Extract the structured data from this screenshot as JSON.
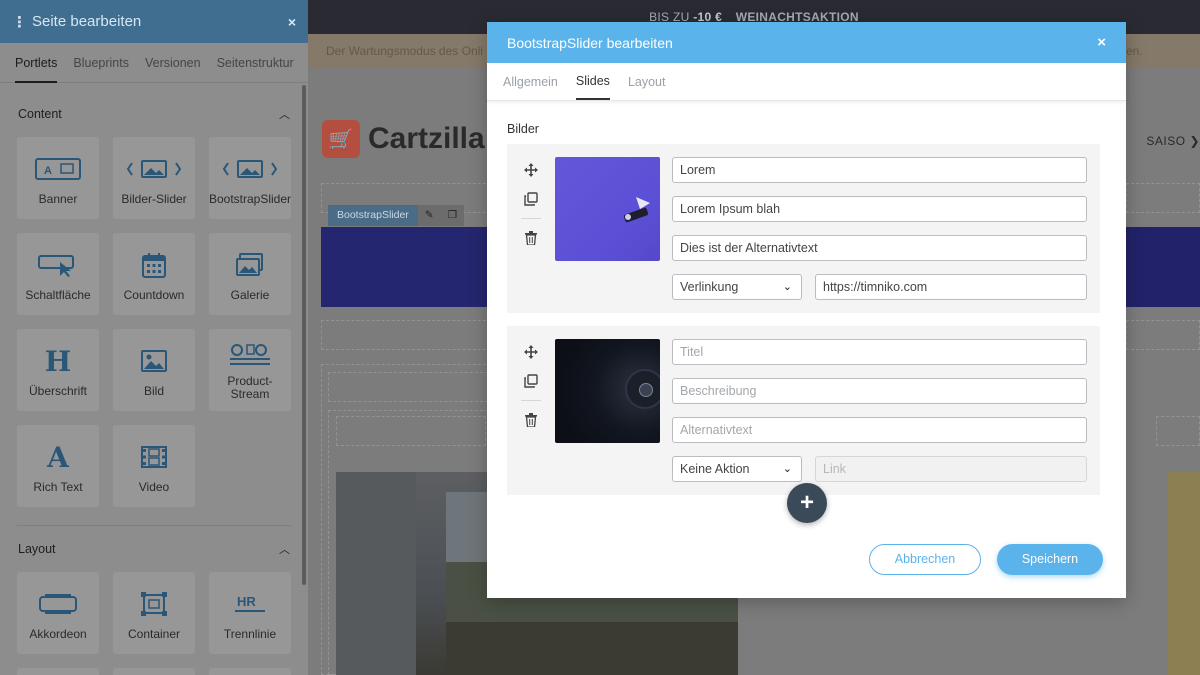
{
  "sidebar": {
    "title": "Seite bearbeiten",
    "close_icon": "×",
    "tabs": [
      "Portlets",
      "Blueprints",
      "Versionen",
      "Seitenstruktur"
    ],
    "sections": [
      {
        "label": "Content",
        "items": [
          {
            "label": "Banner",
            "icon": "banner-icon"
          },
          {
            "label": "Bilder-Slider",
            "icon": "image-slider-icon"
          },
          {
            "label": "BootstrapSlider",
            "icon": "image-slider-icon"
          },
          {
            "label": "Schaltfläche",
            "icon": "button-cursor-icon"
          },
          {
            "label": "Countdown",
            "icon": "calendar-icon"
          },
          {
            "label": "Galerie",
            "icon": "gallery-icon"
          },
          {
            "label": "Überschrift",
            "icon": "heading-icon"
          },
          {
            "label": "Bild",
            "icon": "image-icon"
          },
          {
            "label": "Product-\nStream",
            "icon": "product-stream-icon"
          },
          {
            "label": "Rich Text",
            "icon": "rich-text-icon"
          },
          {
            "label": "Video",
            "icon": "film-icon"
          }
        ]
      },
      {
        "label": "Layout",
        "items": [
          {
            "label": "Akkordeon",
            "icon": "accordion-icon"
          },
          {
            "label": "Container",
            "icon": "container-icon"
          },
          {
            "label": "Trennlinie",
            "icon": "hr-icon"
          }
        ]
      }
    ]
  },
  "page": {
    "topbar_text": "BIS ZU",
    "topbar_amount": "-10 €",
    "topbar_sale": "WEINACHTSAKTION",
    "maintenance_text": "Der Wartungsmodus des Onli",
    "maintenance_tail": "en.",
    "logo_text": "Cartzilla",
    "saison_text": "SAISO",
    "portlet_tag": "BootstrapSlider"
  },
  "modal": {
    "title": "BootstrapSlider bearbeiten",
    "close_icon": "×",
    "tabs": [
      "Allgemein",
      "Slides",
      "Layout"
    ],
    "active_tab": "Slides",
    "section_label": "Bilder",
    "slides": [
      {
        "title": "Lorem",
        "description": "Lorem Ipsum blah",
        "alt": "Dies ist der Alternativtext",
        "action": "Verlinkung",
        "link": "https://timniko.com"
      },
      {
        "title_placeholder": "Titel",
        "description_placeholder": "Beschreibung",
        "alt_placeholder": "Alternativtext",
        "action": "Keine Aktion",
        "link_placeholder": "Link"
      }
    ],
    "cancel_label": "Abbrechen",
    "save_label": "Speichern",
    "add_label": "+"
  }
}
